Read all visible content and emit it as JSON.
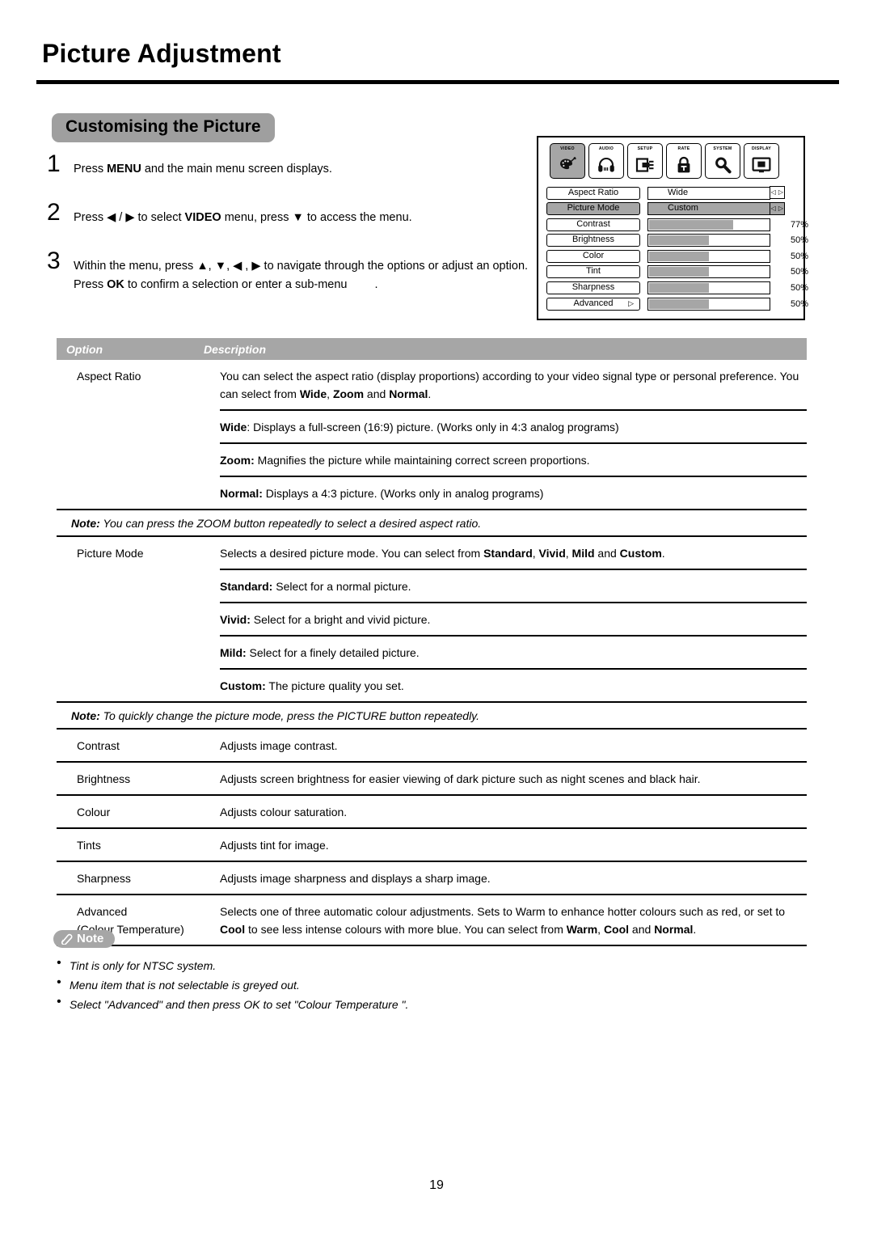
{
  "document": {
    "title": "Picture Adjustment",
    "section_heading": "Customising the Picture",
    "page_number": "19"
  },
  "steps": [
    {
      "number": "1",
      "parts": [
        {
          "t": "Press ",
          "b": false
        },
        {
          "t": "MENU",
          "b": true
        },
        {
          "t": " and the main menu screen displays.",
          "b": false
        }
      ]
    },
    {
      "number": "2",
      "parts": [
        {
          "t": "Press ◀ / ▶ to select ",
          "b": false
        },
        {
          "t": "VIDEO",
          "b": true
        },
        {
          "t": " menu, press ▼ to access the menu.",
          "b": false
        }
      ]
    },
    {
      "number": "3",
      "parts": [
        {
          "t": "Within the menu, press ▲, ▼, ◀ , ▶ to navigate through the options or adjust an option. Press ",
          "b": false
        },
        {
          "t": "OK",
          "b": true
        },
        {
          "t": " to confirm a selection or enter a sub-menu",
          "b": false
        },
        {
          "t": "GAP",
          "b": false
        },
        {
          "t": ".",
          "b": false
        }
      ]
    }
  ],
  "osd": {
    "tabs": [
      {
        "label": "VIDEO",
        "icon": "palette-icon",
        "selected": true
      },
      {
        "label": "AUDIO",
        "icon": "headphones-icon",
        "selected": false
      },
      {
        "label": "SETUP",
        "icon": "plug-icon",
        "selected": false
      },
      {
        "label": "RATE",
        "icon": "lock-icon",
        "selected": false
      },
      {
        "label": "SYSTEM",
        "icon": "magnifier-icon",
        "selected": false
      },
      {
        "label": "DISPLAY",
        "icon": "monitor-icon",
        "selected": false
      }
    ],
    "rows": [
      {
        "label": "Aspect Ratio",
        "type": "value",
        "value": "Wide",
        "arrows": "◁ ▷",
        "highlighted": false,
        "submenu": false
      },
      {
        "label": "Picture Mode",
        "type": "value",
        "value": "Custom",
        "arrows": "◁ ▷",
        "highlighted": true,
        "submenu": false
      },
      {
        "label": "Contrast",
        "type": "bar",
        "percent": "77%",
        "fill": 70,
        "highlighted": false,
        "submenu": false
      },
      {
        "label": "Brightness",
        "type": "bar",
        "percent": "50%",
        "fill": 50,
        "highlighted": false,
        "submenu": false
      },
      {
        "label": "Color",
        "type": "bar",
        "percent": "50%",
        "fill": 50,
        "highlighted": false,
        "submenu": false
      },
      {
        "label": "Tint",
        "type": "bar",
        "percent": "50%",
        "fill": 50,
        "highlighted": false,
        "submenu": false
      },
      {
        "label": "Sharpness",
        "type": "bar",
        "percent": "50%",
        "fill": 50,
        "highlighted": false,
        "submenu": false
      },
      {
        "label": "Advanced",
        "type": "bar",
        "percent": "50%",
        "fill": 50,
        "highlighted": false,
        "submenu": true,
        "submenu_arrow": "▷"
      }
    ]
  },
  "table": {
    "headers": {
      "option": "Option",
      "description": "Description"
    },
    "aspect_ratio": {
      "option": "Aspect Ratio",
      "main_parts": [
        {
          "t": "You can select the aspect ratio (display proportions) according to your video signal type or personal preference. You can select from ",
          "b": false
        },
        {
          "t": "Wide",
          "b": true
        },
        {
          "t": ", ",
          "b": false
        },
        {
          "t": "Zoom",
          "b": true
        },
        {
          "t": " and ",
          "b": false
        },
        {
          "t": "Normal",
          "b": true
        },
        {
          "t": ".",
          "b": false
        }
      ],
      "sub_rows": [
        [
          {
            "t": "Wide",
            "b": true
          },
          {
            "t": ": Displays a full-screen (16:9) picture. (Works only in 4:3 analog programs)",
            "b": false
          }
        ],
        [
          {
            "t": "Zoom:",
            "b": true
          },
          {
            "t": " Magnifies the picture while maintaining correct screen proportions.",
            "b": false
          }
        ],
        [
          {
            "t": "Normal:",
            "b": true
          },
          {
            "t": " Displays a 4:3 picture. (Works only in analog programs)",
            "b": false
          }
        ]
      ],
      "note_lead": "Note:",
      "note_text": " You can press the ZOOM button repeatedly to select a desired aspect ratio."
    },
    "picture_mode": {
      "option": "Picture Mode",
      "main_parts": [
        {
          "t": "Selects a desired picture mode. You can select from ",
          "b": false
        },
        {
          "t": "Standard",
          "b": true
        },
        {
          "t": ", ",
          "b": false
        },
        {
          "t": "Vivid",
          "b": true
        },
        {
          "t": ", ",
          "b": false
        },
        {
          "t": "Mild",
          "b": true
        },
        {
          "t": " and ",
          "b": false
        },
        {
          "t": "Custom",
          "b": true
        },
        {
          "t": ".",
          "b": false
        }
      ],
      "sub_rows": [
        [
          {
            "t": "Standard:",
            "b": true
          },
          {
            "t": " Select for a normal picture.",
            "b": false
          }
        ],
        [
          {
            "t": "Vivid:",
            "b": true
          },
          {
            "t": " Select for a bright and vivid picture.",
            "b": false
          }
        ],
        [
          {
            "t": "Mild:",
            "b": true
          },
          {
            "t": " Select for a finely detailed picture.",
            "b": false
          }
        ],
        [
          {
            "t": "Custom:",
            "b": true
          },
          {
            "t": " The picture quality you set.",
            "b": false
          }
        ]
      ],
      "note_lead": "Note:",
      "note_text": " To quickly change the picture mode, press the PICTURE button repeatedly."
    },
    "simple_rows": [
      {
        "option": "Contrast",
        "parts": [
          {
            "t": "Adjusts image contrast.",
            "b": false
          }
        ]
      },
      {
        "option": "Brightness",
        "parts": [
          {
            "t": "Adjusts screen brightness for easier viewing of dark picture such as night scenes and black hair.",
            "b": false
          }
        ]
      },
      {
        "option": "Colour",
        "parts": [
          {
            "t": "Adjusts colour saturation.",
            "b": false
          }
        ]
      },
      {
        "option": "Tints",
        "parts": [
          {
            "t": "Adjusts tint for image.",
            "b": false
          }
        ]
      },
      {
        "option": "Sharpness",
        "parts": [
          {
            "t": "Adjusts image sharpness and displays a sharp image.",
            "b": false
          }
        ]
      },
      {
        "option": "Advanced\n(Colour Temperature)",
        "parts": [
          {
            "t": "Selects one of three automatic colour adjustments. Sets to Warm to enhance hotter colours such as red, or set to ",
            "b": false
          },
          {
            "t": "Cool",
            "b": true
          },
          {
            "t": " to see less intense colours with more blue. You can select from ",
            "b": false
          },
          {
            "t": "Warm",
            "b": true
          },
          {
            "t": ", ",
            "b": false
          },
          {
            "t": "Cool",
            "b": true
          },
          {
            "t": " and ",
            "b": false
          },
          {
            "t": "Normal",
            "b": true
          },
          {
            "t": ".",
            "b": false
          }
        ]
      }
    ]
  },
  "note_box": {
    "badge_label": "Note",
    "badge_icon": "pencil-icon",
    "bullet": "•",
    "items": [
      "Tint is only for NTSC system.",
      "Menu item that is not selectable is greyed out.",
      "Select \"Advanced\" and then press OK to set \"Colour Temperature \"."
    ]
  }
}
